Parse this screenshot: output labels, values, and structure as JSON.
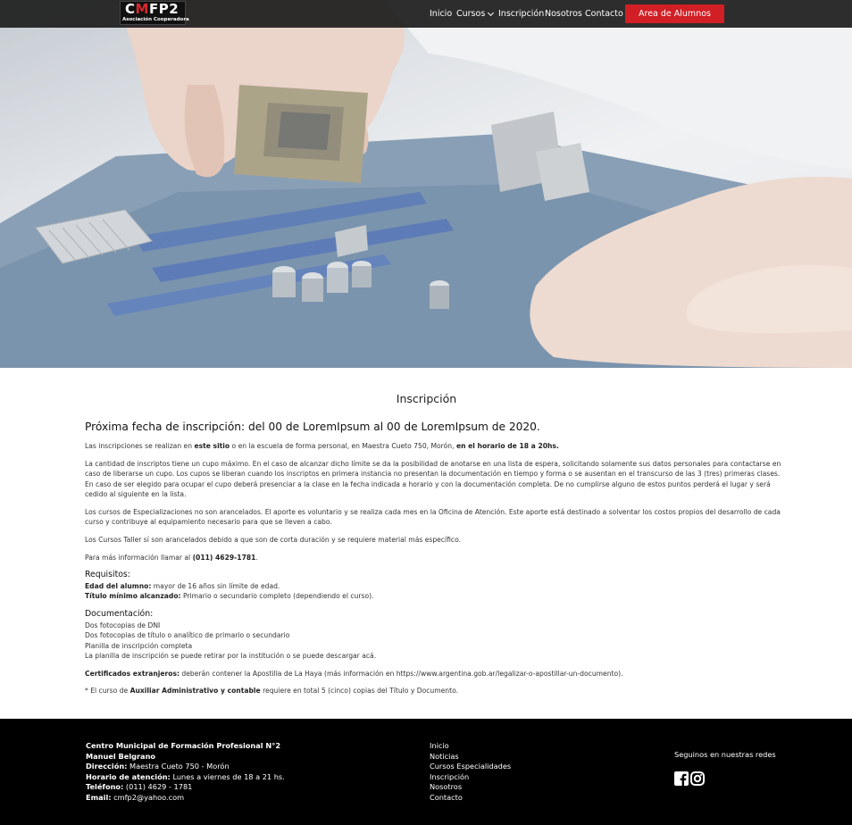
{
  "brand": {
    "logo_main_1": "C",
    "logo_main_red": "M",
    "logo_main_2": "FP2",
    "logo_sub": "Asociación Cooperadora"
  },
  "nav": {
    "items": [
      {
        "label": "Inicio"
      },
      {
        "label": "Cursos"
      },
      {
        "label": "Inscripción"
      },
      {
        "label": "Nosotros"
      },
      {
        "label": "Contacto"
      }
    ],
    "cta_label": "Area de Alumnos"
  },
  "colors": {
    "accent": "#d11f25",
    "navbar": "#1e1e1e",
    "footer": "#000000"
  },
  "main": {
    "title": "Inscripción",
    "headline": "Próxima fecha de inscripción: del 00 de LoremIpsum al 00 de LoremIpsum de 2020.",
    "p1": {
      "a": "Las inscripciones se realizan en ",
      "b": "este sitio",
      "c": " o en la escuela de forma personal, en Maestra Cueto 750, Morón, ",
      "d": "en el horario de 18 a 20hs."
    },
    "p2_lines": [
      "La cantidad de inscriptos tiene un cupo máximo. En el caso de alcanzar dicho límite se da la posibilidad de anotarse en una lista de espera, solicitando solamente sus datos personales para contactarse en",
      "caso de liberarse un cupo. Los cupos se liberan cuando los inscriptos en primera instancia no presentan la documentación en tiempo y forma o se ausentan en el transcurso de las 3 (tres) primeras clases.",
      "En caso de ser elegido para ocupar el cupo deberá presenciar a la clase en la fecha indicada a horario y con la documentación completa. De no cumplirse alguno de estos puntos perderá el lugar y será",
      "cedido al siguiente en la lista."
    ],
    "p3_lines": [
      "Los cursos de Especializaciones no son arancelados. El aporte es voluntario y se realiza cada mes en la Oficina de Atención. Este aporte está destinado a solventar los costos propios del desarrollo de cada",
      "curso y contribuye al equipamiento necesario para que se lleven a cabo."
    ],
    "p4": "Los Cursos Taller sí son arancelados debido a que son de corta duración y se requiere material más específico.",
    "p5": {
      "a": "Para más información llamar al ",
      "b": "(011) 4629-1781",
      "c": "."
    },
    "requisitos_title": "Requisitos:",
    "req1": {
      "label": "Edad del alumno:",
      "value": " mayor de 16 años sin límite de edad."
    },
    "req2": {
      "label": "Título mínimo alcanzado:",
      "value": " Primario o secundario completo (dependiendo el curso)."
    },
    "documentacion_title": "Documentación:",
    "doc_lines": [
      "Dos fotocopias de DNI",
      "Dos fotocopias de título o analítico de primario o secundario",
      "Planilla de inscripción completa",
      "La planilla de inscripción se puede retirar por la institución o se puede descargar acá."
    ],
    "cert": {
      "label": "Certificados extranjeros:",
      "value": " deberán contener la Apostilla de La Haya (más información en https://www.argentina.gob.ar/legalizar-o-apostillar-un-documento)."
    },
    "note": {
      "a": "* El curso de ",
      "b": "Auxiliar Administrativo y contable",
      "c": " requiere en total 5 (cinco) copias del Título y Documento."
    }
  },
  "footer": {
    "org_line1": "Centro Municipal de Formación Profesional N°2",
    "org_line2": "Manuel Belgrano",
    "dir_label": "Dirección:",
    "dir_value": " Maestra Cueto 750 - Morón",
    "hor_label": "Horario de atención:",
    "hor_value": " Lunes a viernes de 18 a 21 hs.",
    "tel_label": "Teléfono:",
    "tel_value": " (011) 4629 - 1781",
    "email_label": "Email:",
    "email_value": " cmfp2@yahoo.com",
    "links": [
      "Inicio",
      "Noticias",
      "Cursos Especialidades",
      "Inscripción",
      "Nosotros",
      "Contacto"
    ],
    "social_title": "Seguinos en nuestras redes",
    "social_icons": [
      "facebook-icon",
      "instagram-icon"
    ]
  }
}
